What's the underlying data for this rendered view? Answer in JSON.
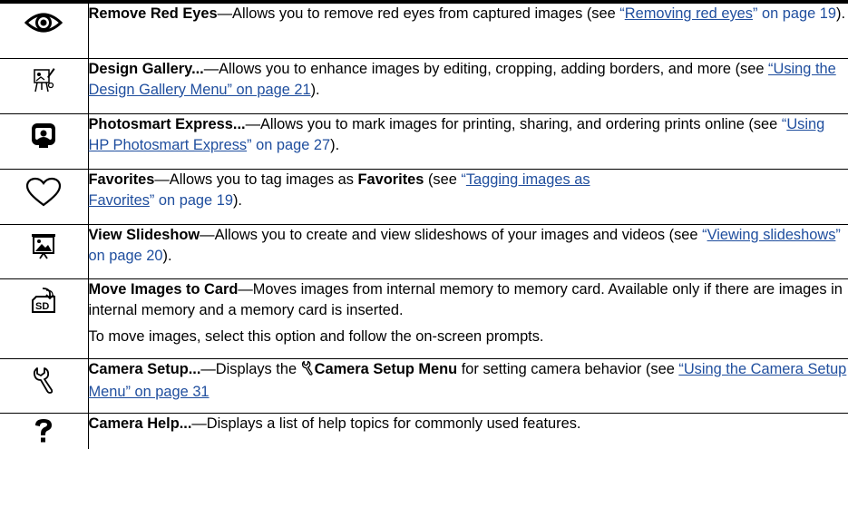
{
  "rows": [
    {
      "icon": "eye-icon",
      "title": "Remove Red Eyes",
      "text": "—Allows you to remove red eyes from captured images (see ",
      "link_open_quote": "“",
      "link_text": "Removing red eyes",
      "link_tail": "” on page 19",
      "after": ")."
    },
    {
      "icon": "design-gallery-icon",
      "title": "Design Gallery...",
      "text": "—Allows you to enhance images by editing, cropping, adding borders, and more (see ",
      "link_full": "“Using the Design Gallery Menu” on page 21",
      "after": ")."
    },
    {
      "icon": "photosmart-express-icon",
      "title": "Photosmart Express...",
      "text": "—Allows you to mark images for printing, sharing, and ordering prints online (see ",
      "link_open_quote": "“",
      "link_text": "Using HP Photosmart Express",
      "link_tail": "” on page 27",
      "after": ")."
    },
    {
      "icon": "heart-icon",
      "title": "Favorites",
      "text": "—Allows you to tag images as ",
      "bold_inline": "Favorites",
      "text2": " (see ",
      "link_open_quote": "“",
      "link_text_line1": "Tagging images as",
      "link_text_line2": "Favorites",
      "link_tail": "” on page 19",
      "after": ")."
    },
    {
      "icon": "slideshow-icon",
      "title": "View Slideshow",
      "text": "—Allows you to create and view slideshows of your images and videos (see ",
      "link_open_quote": "“",
      "link_text": "Viewing slideshows",
      "link_tail": "” on page 20",
      "after": ")."
    },
    {
      "icon": "move-to-sd-icon",
      "title": "Move Images to Card",
      "text": "—Moves images from internal memory to memory card. Available only if there are images in internal memory and a memory card is inserted.",
      "para2": "To move images, select this option and follow the on-screen prompts."
    },
    {
      "icon": "wrench-icon",
      "title": "Camera Setup...",
      "text": "—Displays the ",
      "bold_inline": "Camera Setup Menu",
      "text2": " for setting camera behavior (see ",
      "link_full": "“Using the Camera Setup Menu” on page 31"
    },
    {
      "icon": "question-mark-icon",
      "title": "Camera Help...",
      "text": "—Displays a list of help topics for commonly used features."
    }
  ],
  "colors": {
    "link": "#1f4e9e",
    "rule": "#000000"
  }
}
